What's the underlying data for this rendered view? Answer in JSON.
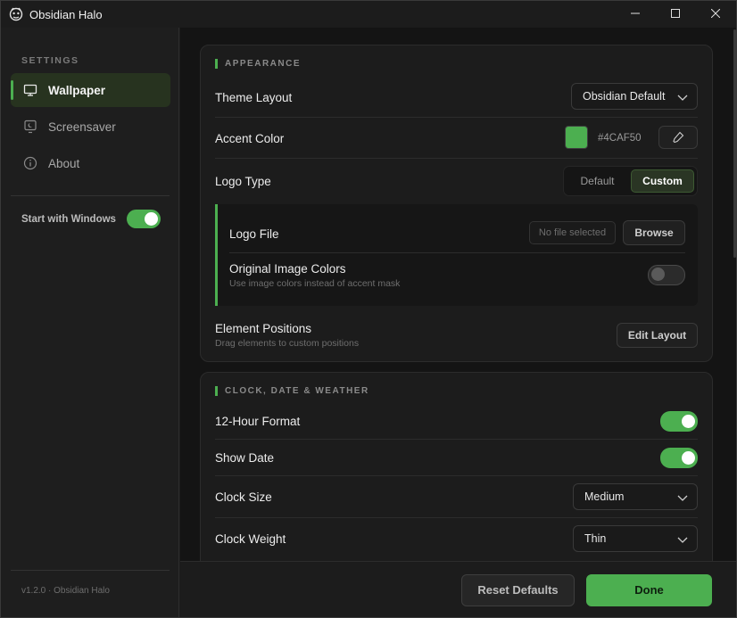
{
  "window": {
    "title": "Obsidian Halo",
    "controls": {
      "minimize": "minimize-icon",
      "maximize": "maximize-icon",
      "close": "close-icon"
    }
  },
  "sidebar": {
    "heading": "SETTINGS",
    "items": [
      {
        "label": "Wallpaper",
        "icon": "monitor-icon",
        "active": true
      },
      {
        "label": "Screensaver",
        "icon": "screensaver-icon",
        "active": false
      },
      {
        "label": "About",
        "icon": "info-icon",
        "active": false
      }
    ],
    "start_with_windows": {
      "label": "Start with Windows",
      "enabled": true
    },
    "version": "v1.2.0 · Obsidian Halo"
  },
  "appearance": {
    "heading": "APPEARANCE",
    "theme_layout": {
      "label": "Theme Layout",
      "value": "Obsidian Default"
    },
    "accent_color": {
      "label": "Accent Color",
      "hex": "#4CAF50",
      "swatch": "#4caf50",
      "picker_icon": "eyedropper-icon"
    },
    "logo_type": {
      "label": "Logo Type",
      "options": [
        "Default",
        "Custom"
      ],
      "selected": "Custom"
    },
    "logo_file": {
      "label": "Logo File",
      "placeholder": "No file selected",
      "browse": "Browse"
    },
    "original_colors": {
      "label": "Original Image Colors",
      "sub": "Use image colors instead of accent mask",
      "enabled": false
    },
    "element_positions": {
      "label": "Element Positions",
      "sub": "Drag elements to custom positions",
      "button": "Edit Layout"
    }
  },
  "clock": {
    "heading": "CLOCK, DATE & WEATHER",
    "hour12": {
      "label": "12-Hour Format",
      "enabled": true
    },
    "show_date": {
      "label": "Show Date",
      "enabled": true
    },
    "clock_size": {
      "label": "Clock Size",
      "value": "Medium"
    },
    "clock_weight": {
      "label": "Clock Weight",
      "value": "Thin"
    }
  },
  "footer": {
    "reset": "Reset Defaults",
    "done": "Done"
  },
  "colors": {
    "accent": "#4caf50",
    "background": "#141414",
    "panel": "#1c1c1c"
  }
}
